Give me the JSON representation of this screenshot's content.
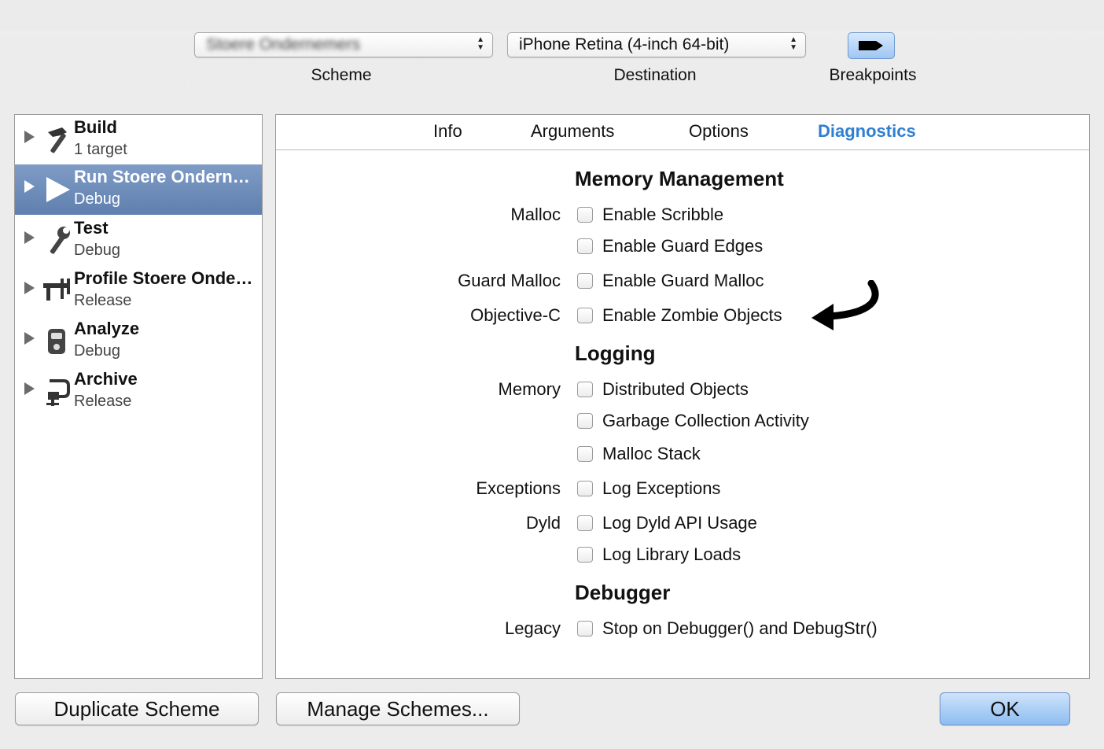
{
  "toolbar": {
    "scheme_value": "Stoere Ondernemers",
    "scheme_label": "Scheme",
    "destination_value": "iPhone Retina (4-inch 64-bit)",
    "destination_label": "Destination",
    "breakpoints_label": "Breakpoints"
  },
  "sidebar": {
    "items": [
      {
        "title": "Build",
        "subtitle": "1 target",
        "icon": "hammer-icon"
      },
      {
        "title": "Run Stoere Ondernemers",
        "subtitle": "Debug",
        "icon": "play-icon",
        "selected": true
      },
      {
        "title": "Test",
        "subtitle": "Debug",
        "icon": "wrench-icon"
      },
      {
        "title": "Profile Stoere Ondernemers",
        "subtitle": "Release",
        "icon": "caliper-icon"
      },
      {
        "title": "Analyze",
        "subtitle": "Debug",
        "icon": "analyze-icon"
      },
      {
        "title": "Archive",
        "subtitle": "Release",
        "icon": "archive-icon"
      }
    ]
  },
  "tabs": [
    {
      "label": "Info"
    },
    {
      "label": "Arguments"
    },
    {
      "label": "Options"
    },
    {
      "label": "Diagnostics",
      "active": true
    }
  ],
  "diagnostics": {
    "memory_management": "Memory Management",
    "malloc_label": "Malloc",
    "enable_scribble": "Enable Scribble",
    "enable_guard_edges": "Enable Guard Edges",
    "guard_malloc_label": "Guard Malloc",
    "enable_guard_malloc": "Enable Guard Malloc",
    "objc_label": "Objective-C",
    "enable_zombie_objects": "Enable Zombie Objects",
    "logging": "Logging",
    "memory_label": "Memory",
    "distributed_objects": "Distributed Objects",
    "gc_activity": "Garbage Collection Activity",
    "malloc_stack": "Malloc Stack",
    "exceptions_label": "Exceptions",
    "log_exceptions": "Log Exceptions",
    "dyld_label": "Dyld",
    "log_dyld_api": "Log Dyld API Usage",
    "log_library_loads": "Log Library Loads",
    "debugger": "Debugger",
    "legacy_label": "Legacy",
    "stop_on_debugger": "Stop on Debugger() and DebugStr()"
  },
  "buttons": {
    "duplicate": "Duplicate Scheme",
    "manage": "Manage Schemes...",
    "ok": "OK"
  },
  "colors": {
    "accent_tab": "#2f7fd3",
    "selection": "#6f8dba",
    "ok_button": "#8dbdf1"
  }
}
